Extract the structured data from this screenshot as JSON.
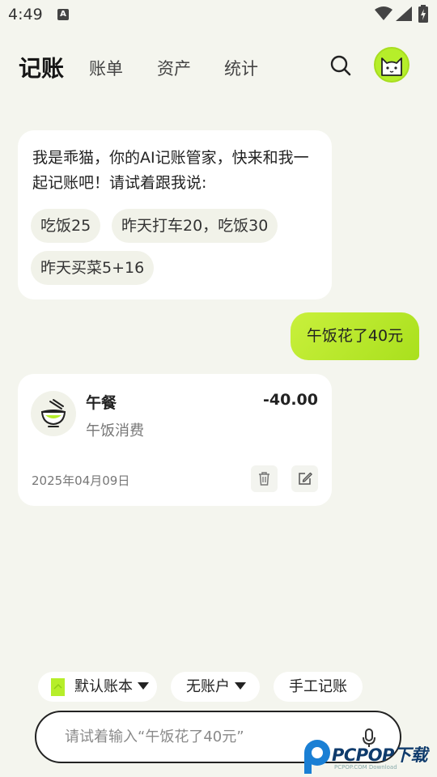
{
  "status_bar": {
    "time": "4:49",
    "notification_icon": "A"
  },
  "header": {
    "title": "记账",
    "tabs": [
      "账单",
      "资产",
      "统计"
    ]
  },
  "chat": {
    "bot_message": "我是乖猫，你的AI记账管家，快来和我一起记账吧！请试着跟我说:",
    "suggestions": [
      "吃饭25",
      "昨天打车20，吃饭30",
      "昨天买菜5+16"
    ],
    "user_message": "午饭花了40元"
  },
  "record": {
    "category": "午餐",
    "amount": "-40.00",
    "note": "午饭消费",
    "date": "2025年04月09日"
  },
  "bottom": {
    "book_label": "默认账本",
    "account_label": "无账户",
    "manual_label": "手工记账",
    "input_placeholder": "请试着输入“午饭花了40元”"
  },
  "watermark": {
    "text": "PCPOP下载",
    "subtext": "PCPOP.COM Download"
  },
  "colors": {
    "accent": "#b6ee2a",
    "background": "#f4f5ee",
    "card": "#ffffff"
  }
}
